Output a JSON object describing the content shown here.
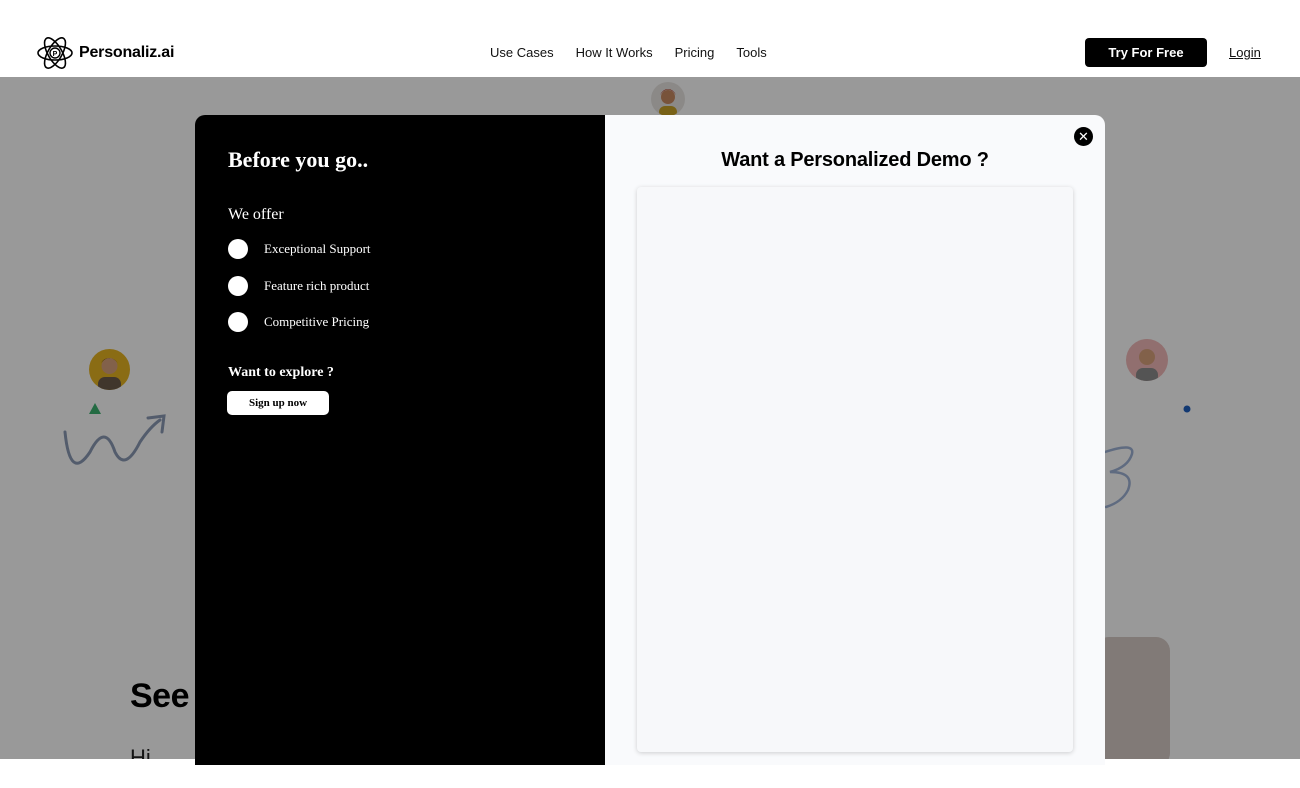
{
  "header": {
    "logo_text": "Personaliz.ai",
    "nav": [
      "Use Cases",
      "How It Works",
      "Pricing",
      "Tools"
    ],
    "try_label": "Try For Free",
    "login_label": "Login"
  },
  "background": {
    "hero_heading": "See",
    "hero_subtext": "Hi"
  },
  "modal": {
    "left": {
      "title": "Before you go..",
      "offer_heading": "We offer",
      "items": [
        "Exceptional Support",
        "Feature rich product",
        "Competitive Pricing"
      ],
      "explore": "Want to explore ?",
      "signup_label": "Sign up now"
    },
    "right": {
      "title": "Want a Personalized Demo ?"
    },
    "close_icon": "close-icon"
  },
  "colors": {
    "overlay": "rgba(0,0,0,0.40)",
    "modal_left_bg": "#000000",
    "modal_right_bg": "#f9fafc",
    "accent_green": "#3cb371",
    "accent_blue": "#1f5fbf"
  }
}
